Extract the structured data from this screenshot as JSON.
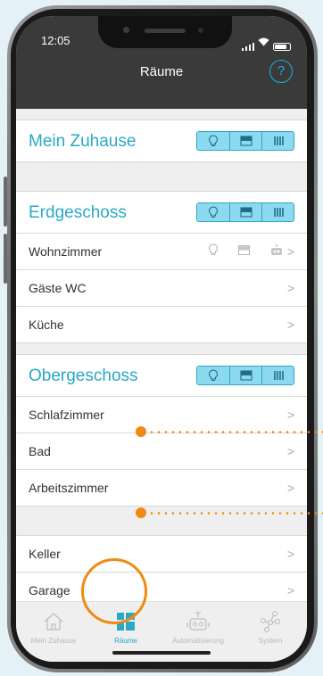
{
  "status_bar": {
    "time": "12:05"
  },
  "header": {
    "title": "Räume",
    "help_label": "?"
  },
  "sections": [
    {
      "title": "Mein Zuhause",
      "rooms": []
    },
    {
      "title": "Erdgeschoss",
      "rooms": [
        {
          "name": "Wohnzimmer"
        },
        {
          "name": "Gäste WC"
        },
        {
          "name": "Küche"
        }
      ]
    },
    {
      "title": "Obergeschoss",
      "rooms": [
        {
          "name": "Schlafzimmer"
        },
        {
          "name": "Bad"
        },
        {
          "name": "Arbeitszimmer"
        }
      ]
    },
    {
      "title": "",
      "rooms": [
        {
          "name": "Keller"
        },
        {
          "name": "Garage"
        }
      ]
    }
  ],
  "segment_icons": [
    "bulb-icon",
    "blind-icon",
    "radiator-icon"
  ],
  "chevron": ">",
  "tabs": [
    {
      "label": "Mein Zuhause",
      "icon": "house-icon",
      "active": false
    },
    {
      "label": "Räume",
      "icon": "rooms-icon",
      "active": true
    },
    {
      "label": "Automatisierung",
      "icon": "robot-icon",
      "active": false
    },
    {
      "label": "System",
      "icon": "network-icon",
      "active": false
    }
  ],
  "colors": {
    "accent": "#2aa8c6",
    "segment_fill": "#8ddaf0",
    "highlight": "#f08a12",
    "header_bg": "#3a3a3a"
  }
}
